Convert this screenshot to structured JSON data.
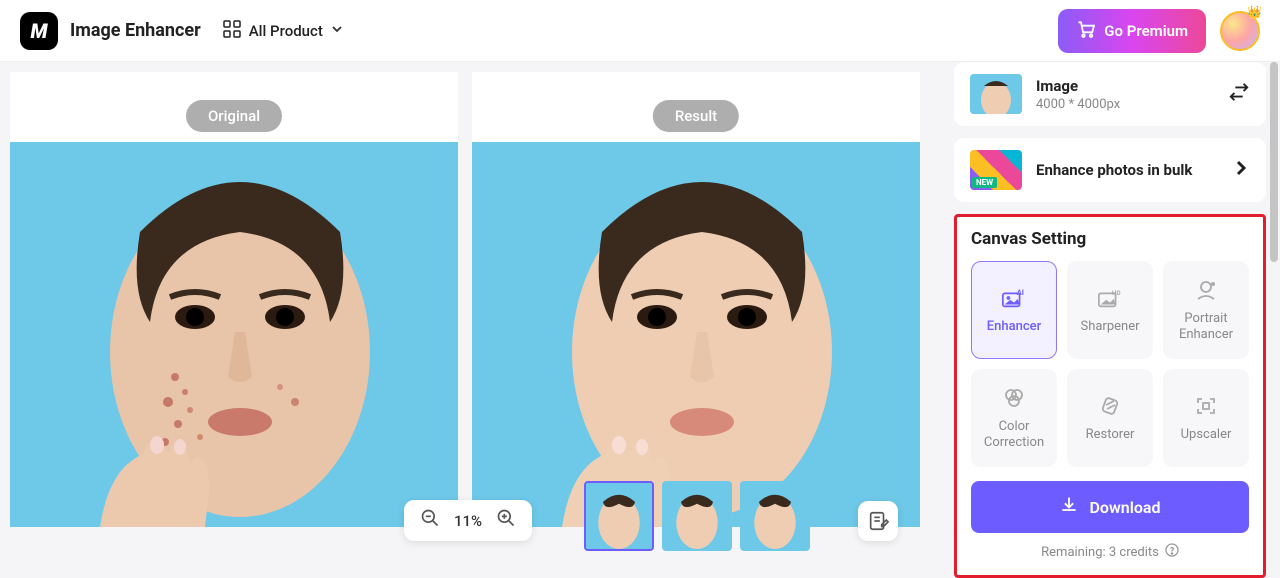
{
  "header": {
    "app_title": "Image Enhancer",
    "all_product": "All Product",
    "premium": "Go Premium"
  },
  "panels": {
    "original": "Original",
    "result": "Result"
  },
  "zoom": {
    "value": "11%"
  },
  "sidebar": {
    "image_card": {
      "title": "Image",
      "dimensions": "4000 * 4000px"
    },
    "bulk_card": {
      "title": "Enhance photos in bulk",
      "badge": "NEW"
    }
  },
  "canvas_setting": {
    "title": "Canvas Setting",
    "tools": [
      {
        "label": "Enhancer",
        "active": true
      },
      {
        "label": "Sharpener",
        "active": false
      },
      {
        "label": "Portrait Enhancer",
        "active": false
      },
      {
        "label": "Color Correction",
        "active": false
      },
      {
        "label": "Restorer",
        "active": false
      },
      {
        "label": "Upscaler",
        "active": false
      }
    ],
    "download": "Download",
    "credits": "Remaining: 3 credits"
  }
}
